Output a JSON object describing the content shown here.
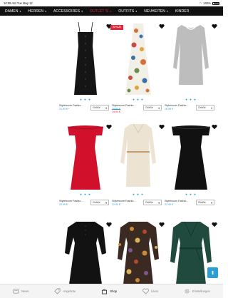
{
  "status": {
    "time": "10:08 AM",
    "date": "Tue May 12",
    "battery": "100%"
  },
  "nav": {
    "items": [
      {
        "label": "DAMEN",
        "caret": "▾"
      },
      {
        "label": "HERREN",
        "caret": "▾"
      },
      {
        "label": "ACCESSOIRES",
        "caret": "▾"
      },
      {
        "label": "OUTLET %",
        "caret": "▾"
      },
      {
        "label": "OUTFITS",
        "caret": "▾"
      },
      {
        "label": "NEUHEITEN",
        "caret": "▾"
      },
      {
        "label": "KINDER",
        "caret": ""
      }
    ]
  },
  "colors": {
    "accent": "#2a9fd6",
    "sale": "#e0283a",
    "nav_bg": "#111111"
  },
  "products": [
    {
      "name": "Styleboom Fashio...",
      "price": "21,90 €",
      "price_sub": "*",
      "old_price": "",
      "size_label": "Größe",
      "dots": "● ● ●",
      "sale_badge": "",
      "image": "black-sundress"
    },
    {
      "name": "Styleboom Fashio...",
      "price": "",
      "price_sub": "",
      "old_price": "29,99 €",
      "sale_price": "19,94 €",
      "size_label": "Größe",
      "dots": "● ● ●",
      "sale_badge": "SALE",
      "image": "floral-maxi-dress"
    },
    {
      "name": "Styleboom Fashio...",
      "price": "19,99 €",
      "price_sub": "",
      "old_price": "",
      "size_label": "Größe",
      "dots": "● ● ●",
      "sale_badge": "",
      "image": "grey-sweater-dress"
    },
    {
      "name": "Styleboom Fashio...",
      "price": "22,90 €",
      "price_sub": "",
      "old_price": "",
      "size_label": "Größe",
      "dots": "● ● ●",
      "sale_badge": "",
      "image": "red-offshoulder-dress"
    },
    {
      "name": "Styleboom Fashio...",
      "price": "22,90 €",
      "price_sub": "",
      "old_price": "",
      "size_label": "Größe",
      "dots": "● ● ●",
      "sale_badge": "",
      "image": "cream-knit-dress"
    },
    {
      "name": "Styleboom Fashio...",
      "price": "22,90 €",
      "price_sub": "",
      "old_price": "",
      "size_label": "Größe",
      "dots": "● ● ●",
      "sale_badge": "",
      "image": "black-offshoulder-dress"
    },
    {
      "image": "black-peasant-dress",
      "favorite_icon": "heart-icon"
    },
    {
      "image": "paisley-print-dress",
      "favorite_icon": "heart-icon"
    },
    {
      "image": "green-wrap-dress",
      "favorite_icon": "heart-icon"
    }
  ],
  "tabbar": {
    "items": [
      {
        "label": "News",
        "icon": "news-icon"
      },
      {
        "label": "Angebote",
        "icon": "tag-icon"
      },
      {
        "label": "Shop",
        "icon": "bag-icon"
      },
      {
        "label": "Likes",
        "icon": "heart-icon"
      },
      {
        "label": "Einstellungen",
        "icon": "gear-icon"
      }
    ]
  }
}
